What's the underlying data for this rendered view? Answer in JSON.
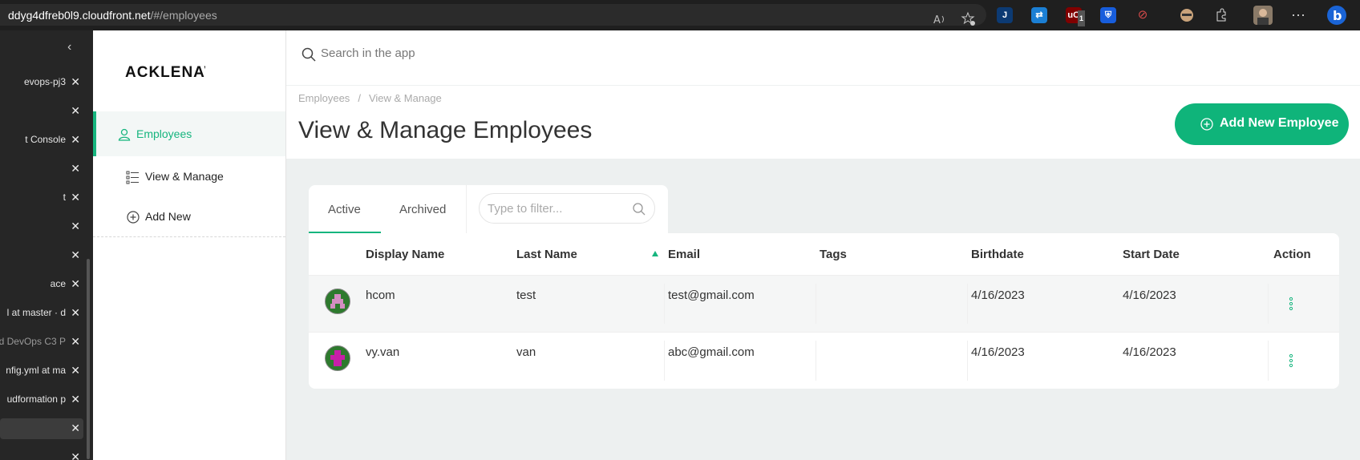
{
  "browser": {
    "url_host": "ddyg4dfreb0l9.cloudfront.net",
    "url_path": "/#/employees",
    "icons": [
      "read-aloud-icon",
      "favorites-add-icon",
      "extension-j-icon",
      "extension-translate-icon",
      "extension-ublock-icon",
      "extension-bitwarden-icon",
      "extension-disabled-icon",
      "extension-incognito-icon",
      "extensions-icon",
      "profile-avatar-icon",
      "more-icon",
      "bing-copilot-icon"
    ],
    "ublock_badge": "1"
  },
  "vertical_tabs": [
    {
      "label": "evops-pj3"
    },
    {
      "label": ""
    },
    {
      "label": "t Console"
    },
    {
      "label": ""
    },
    {
      "label": "t"
    },
    {
      "label": ""
    },
    {
      "label": ""
    },
    {
      "label": "ace"
    },
    {
      "label": "l at master · d"
    },
    {
      "label": "d DevOps C3 P"
    },
    {
      "label": "nfig.yml at ma"
    },
    {
      "label": "udformation p"
    },
    {
      "label": ""
    },
    {
      "label": ""
    }
  ],
  "sidebar": {
    "logo": "ACKLENAV",
    "items": [
      {
        "label": "Employees",
        "icon": "user-icon",
        "active": true
      },
      {
        "label": "View & Manage",
        "icon": "list-icon",
        "active": false
      },
      {
        "label": "Add New",
        "icon": "plus-circle-icon",
        "active": false
      }
    ]
  },
  "header": {
    "search_placeholder": "Search in the app",
    "breadcrumb": [
      "Employees",
      "View & Manage"
    ],
    "breadcrumb_separator": "/",
    "title": "View & Manage Employees",
    "add_button": "Add New Employee"
  },
  "tabs": {
    "items": [
      "Active",
      "Archived"
    ],
    "active": "Active",
    "filter_placeholder": "Type to filter..."
  },
  "table": {
    "columns": [
      "Display Name",
      "Last Name",
      "Email",
      "Tags",
      "Birthdate",
      "Start Date",
      "Action"
    ],
    "sorted_column": "Email",
    "rows": [
      {
        "display_name": "hcom",
        "last_name": "test",
        "email": "test@gmail.com",
        "tags": "",
        "birthdate": "4/16/2023",
        "start_date": "4/16/2023"
      },
      {
        "display_name": "vy.van",
        "last_name": "van",
        "email": "abc@gmail.com",
        "tags": "",
        "birthdate": "4/16/2023",
        "start_date": "4/16/2023"
      }
    ]
  },
  "colors": {
    "accent": "#16b57e",
    "button": "#0fb47a",
    "background": "#edf0f0"
  }
}
